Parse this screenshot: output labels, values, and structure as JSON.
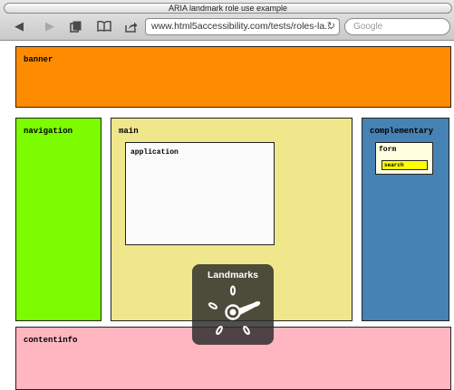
{
  "window": {
    "title": "ARIA landmark role use example"
  },
  "toolbar": {
    "back_icon": "back-arrow-icon",
    "forward_icon": "forward-arrow-icon",
    "tabs_icon": "tabs-icon",
    "bookmarks_icon": "bookmarks-icon",
    "share_icon": "share-icon",
    "url": "www.html5accessibility.com/tests/roles-la...",
    "reload_icon": "reload-icon",
    "search_placeholder": "Google"
  },
  "page": {
    "banner": "banner",
    "navigation": "navigation",
    "main": "main",
    "application": "application",
    "complementary": "complementary",
    "form": "form",
    "search": "search",
    "contentinfo": "contentinfo"
  },
  "rotor": {
    "title": "Landmarks"
  },
  "colors": {
    "banner": "#ff8c00",
    "navigation": "#7cfc00",
    "main": "#f0e68c",
    "complementary": "#4682b4",
    "contentinfo": "#ffb6c1",
    "search": "#ffff00"
  }
}
